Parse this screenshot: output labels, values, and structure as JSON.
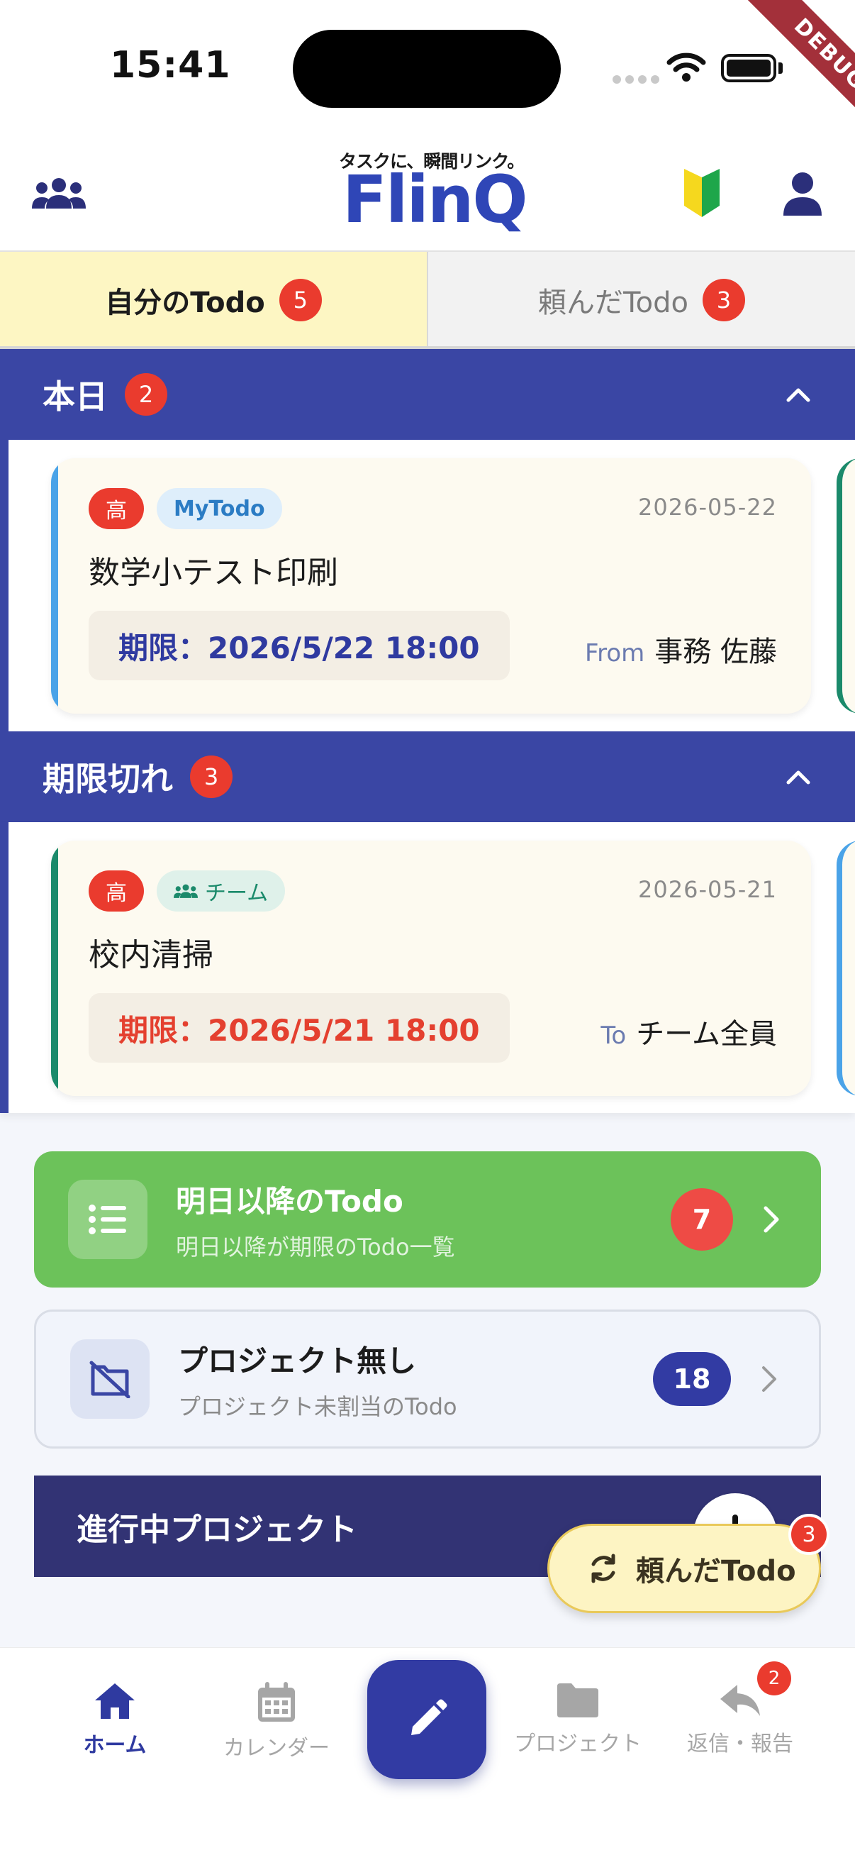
{
  "status_bar": {
    "time": "15:41",
    "debug": "DEBUG"
  },
  "header": {
    "tagline": "タスクに、瞬間リンク。",
    "logo": "FlinQ",
    "icons": [
      "team-icon",
      "beginner-mark-icon",
      "user-icon"
    ]
  },
  "tabs": [
    {
      "label": "自分のTodo",
      "count": "5",
      "active": true
    },
    {
      "label": "頼んだTodo",
      "count": "3",
      "active": false
    }
  ],
  "sections": [
    {
      "title": "本日",
      "count": "2",
      "card": {
        "priority": "高",
        "tag": "MyTodo",
        "date": "2026-05-22",
        "title": "数学小テスト印刷",
        "deadline": "期限：2026/5/22 18:00",
        "direction_label": "From",
        "person": "事務 佐藤"
      }
    },
    {
      "title": "期限切れ",
      "count": "3",
      "card": {
        "priority": "高",
        "tag": "チーム",
        "date": "2026-05-21",
        "title": "校内清掃",
        "deadline": "期限：2026/5/21 18:00",
        "direction_label": "To",
        "person": "チーム全員"
      }
    }
  ],
  "future_todo": {
    "title": "明日以降のTodo",
    "subtitle": "明日以降が期限のTodo一覧",
    "count": "7"
  },
  "no_project": {
    "title": "プロジェクト無し",
    "subtitle": "プロジェクト未割当のTodo",
    "count": "18"
  },
  "ongoing": {
    "title": "進行中プロジェクト",
    "plus": "+"
  },
  "fab_request": {
    "label": "頼んだTodo",
    "count": "3"
  },
  "bottom_nav": {
    "home": "ホーム",
    "calendar": "カレンダー",
    "project": "プロジェクト",
    "reply": "返信・報告",
    "reply_count": "2"
  },
  "colors": {
    "primary": "#3a46a4",
    "accent_red": "#ea3b2e",
    "green": "#6cc25a",
    "today_edge": "#4aa3e8",
    "overdue_edge": "#1b8a6b"
  }
}
